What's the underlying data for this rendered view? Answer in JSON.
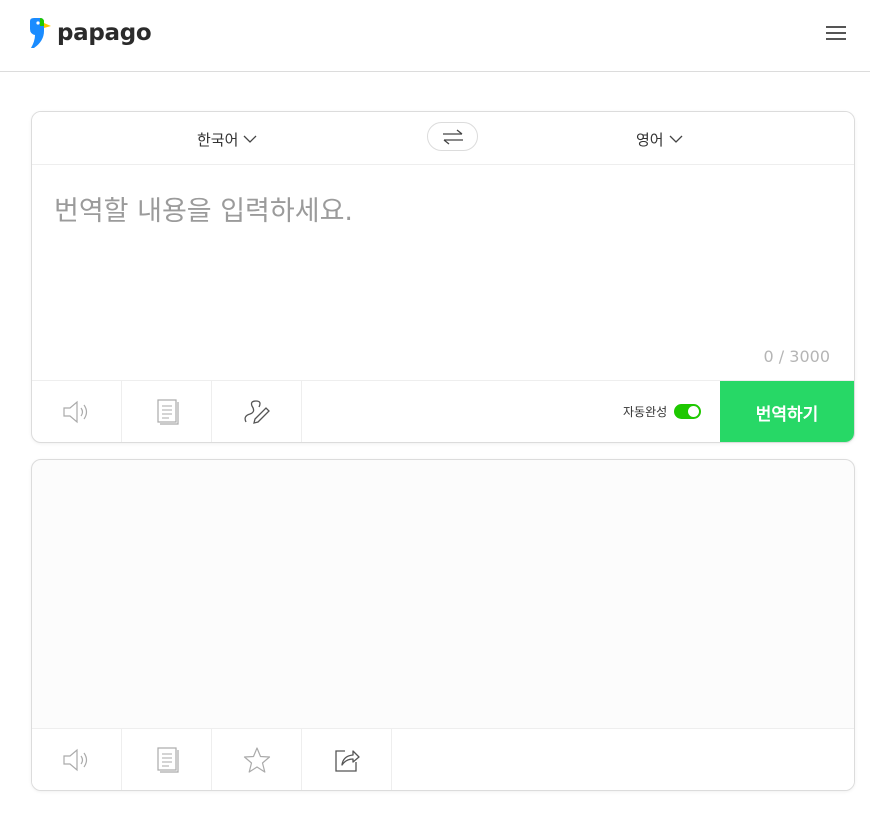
{
  "header": {
    "logo_text": "papago",
    "menu_icon": "hamburger-menu-icon"
  },
  "source": {
    "language": "한국어",
    "placeholder": "번역할 내용을 입력하세요.",
    "char_count": "0 / 3000",
    "autocomplete_label": "자동완성",
    "autocomplete_on": true,
    "translate_label": "번역하기",
    "tools": [
      "speaker-icon",
      "document-icon",
      "handwriting-icon"
    ]
  },
  "target": {
    "language": "영어",
    "tools": [
      "speaker-icon",
      "copy-icon",
      "star-icon",
      "share-icon"
    ]
  },
  "swap_icon": "swap-arrows-icon",
  "colors": {
    "brand_green": "#1ec800",
    "translate_button": "#27d866",
    "logo_blue": "#1a8cff",
    "logo_green": "#1ec800",
    "logo_yellow": "#ffc800"
  }
}
